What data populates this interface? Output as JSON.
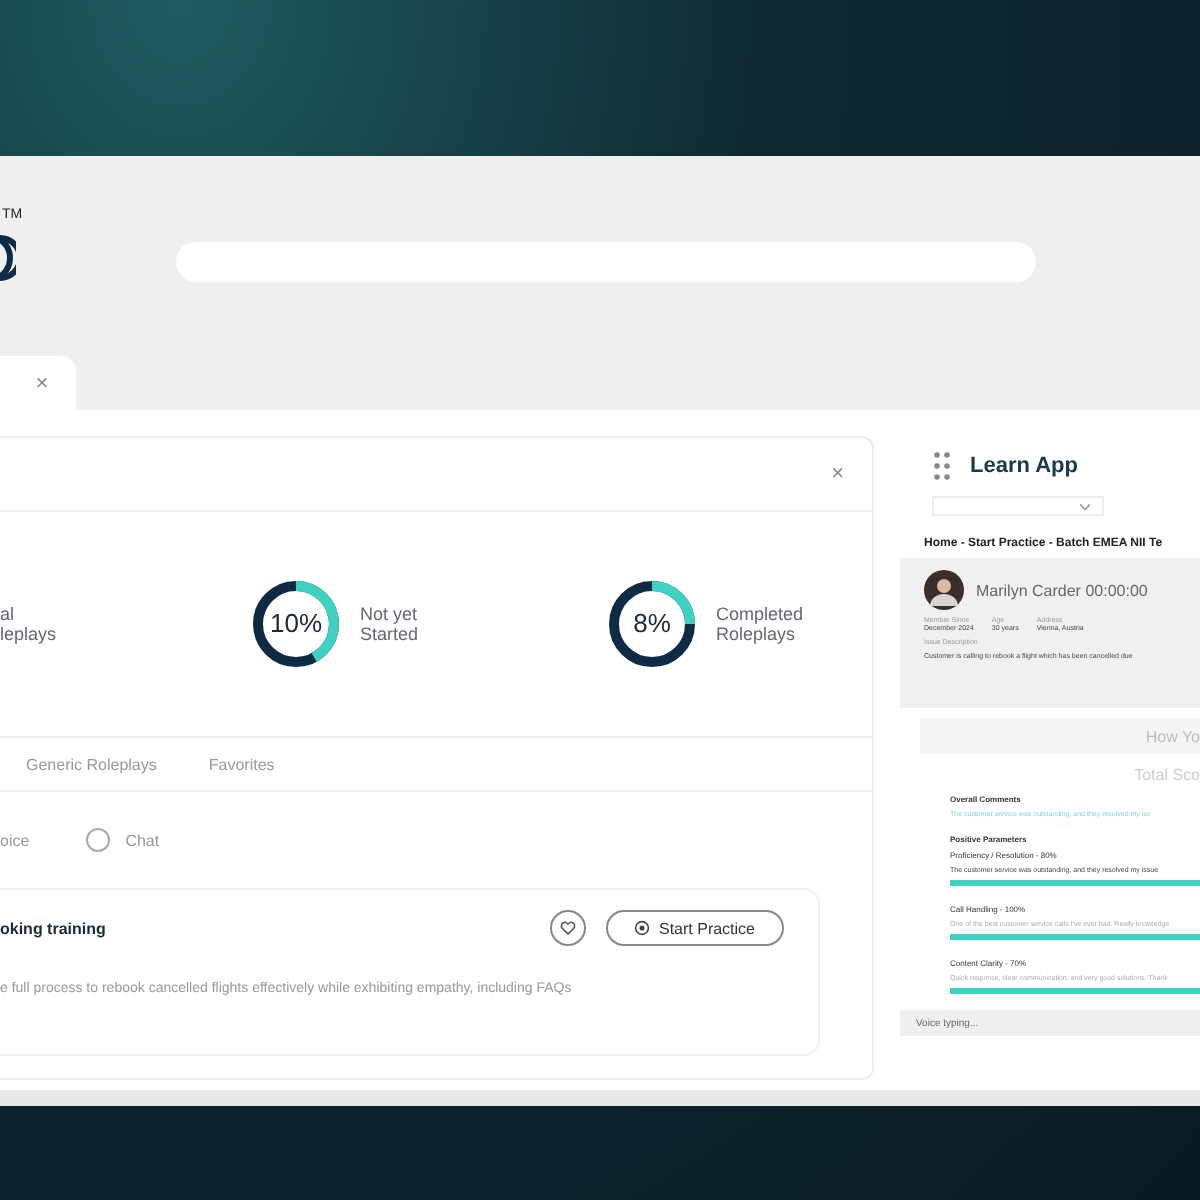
{
  "logo": {
    "mark": "TM"
  },
  "open_tab": {
    "close": "×"
  },
  "panel": {
    "close": "×"
  },
  "stats": [
    {
      "label_lines": [
        "al",
        "leplays"
      ],
      "kind": "text"
    },
    {
      "value": "10%",
      "label_lines": [
        "Not yet",
        "Started"
      ],
      "kind": "donut",
      "level": 0.42
    },
    {
      "value": "8%",
      "label_lines": [
        "Completed",
        "Roleplays"
      ],
      "kind": "donut",
      "level": 0.25
    }
  ],
  "tabs": [
    {
      "label": "Generic Roleplays",
      "selected": false
    },
    {
      "label": "Favorites",
      "selected": false
    }
  ],
  "mode_options": [
    {
      "label": "oice",
      "kind": "label"
    },
    {
      "label": "Chat",
      "kind": "radio",
      "selected": false
    }
  ],
  "roleplay": {
    "title": "oking training",
    "description": "e full process to rebook cancelled flights effectively while exhibiting empathy, including FAQs",
    "button": "Start Practice",
    "favorite": false
  },
  "side": {
    "title": "Learn App",
    "breadcrumb": "Home - Start Practice - Batch EMEA NII Te",
    "name": "Marilyn Carder",
    "timer": "00:00:00",
    "fields": [
      {
        "label": "Member Since",
        "value": "December 2024"
      },
      {
        "label": "Age",
        "value": "30 years"
      },
      {
        "label": "Address",
        "value": "Vienna, Austria"
      }
    ],
    "issue_label": "Issue Description",
    "issue": "Customer is calling to rebook a flight which has been cancelled due",
    "how": "How Yo",
    "total": "Total Sco",
    "overall_label": "Overall Comments",
    "overall": "The customer service was outstanding, and they resolved my iss",
    "positive_label": "Positive Parameters",
    "scores": [
      {
        "name": "Proficiency / Resolution - 80%",
        "comment": "The customer service was outstanding, and they resolved my issue",
        "level": 0.8,
        "strong": true
      },
      {
        "name": "Call Handling - 100%",
        "comment": "One of the best customer service calls I've ever had. Really knowledge",
        "level": 1,
        "strong": false
      },
      {
        "name": "Content Clarity - 70%",
        "comment": "Quick response, clear communication, and very good solutions. Thank",
        "level": 1,
        "strong": false
      }
    ],
    "voice": "Voice typing..."
  }
}
